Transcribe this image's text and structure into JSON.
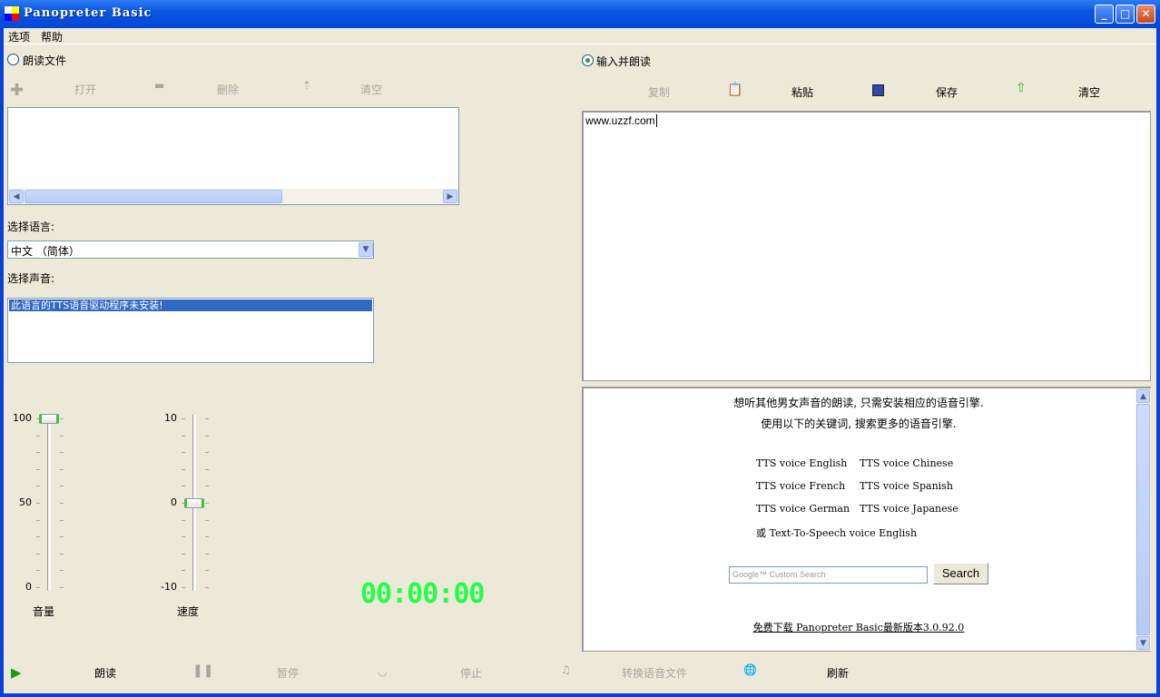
{
  "window": {
    "title": "Panopreter Basic"
  },
  "menu": [
    "选项",
    "帮助"
  ],
  "left": {
    "read_file_label": "朗读文件",
    "read_file_selected": false,
    "toolbar": {
      "open": "打开",
      "delete": "删除",
      "clear": "清空"
    },
    "language_label": "选择语言:",
    "language_value": "中文 （简体）",
    "voice_label": "选择声音:",
    "voice_items": [
      "此语言的TTS语音驱动程序未安装!"
    ],
    "volume": {
      "label": "音量",
      "ticks": [
        "100",
        "50",
        "0"
      ],
      "value": 100,
      "min": 0,
      "max": 100
    },
    "speed": {
      "label": "速度",
      "ticks": [
        "10",
        "0",
        "-10"
      ],
      "value": 0,
      "min": -10,
      "max": 10
    },
    "timer": "00:00:00"
  },
  "right": {
    "input_read_label": "输入并朗读",
    "input_read_selected": true,
    "toolbar": {
      "copy": "复制",
      "paste": "粘贴",
      "save": "保存",
      "clear": "清空"
    },
    "text": "www.uzzf.com",
    "info": {
      "line1": "想听其他男女声音的朗读, 只需安装相应的语音引擎.",
      "line2": "使用以下的关键词, 搜索更多的语音引擎.",
      "keywords": [
        [
          "TTS voice English",
          "TTS voice Chinese"
        ],
        [
          "TTS voice French",
          "TTS voice Spanish"
        ],
        [
          "TTS voice German",
          "TTS voice Japanese"
        ]
      ],
      "alt": "或 Text-To-Speech voice English",
      "search_placeholder": "Google™ Custom Search",
      "search_button": "Search",
      "download_link": "免费下载 Panopreter Basic最新版本3.0.92.0"
    }
  },
  "bottom": {
    "read": "朗读",
    "pause": "暂停",
    "stop": "停止",
    "convert": "转换语音文件",
    "refresh": "刷新"
  },
  "colors": {
    "titlebar": "#0348d6",
    "background": "#ece9d8",
    "selection": "#316ac5",
    "timer": "#22ff44"
  }
}
